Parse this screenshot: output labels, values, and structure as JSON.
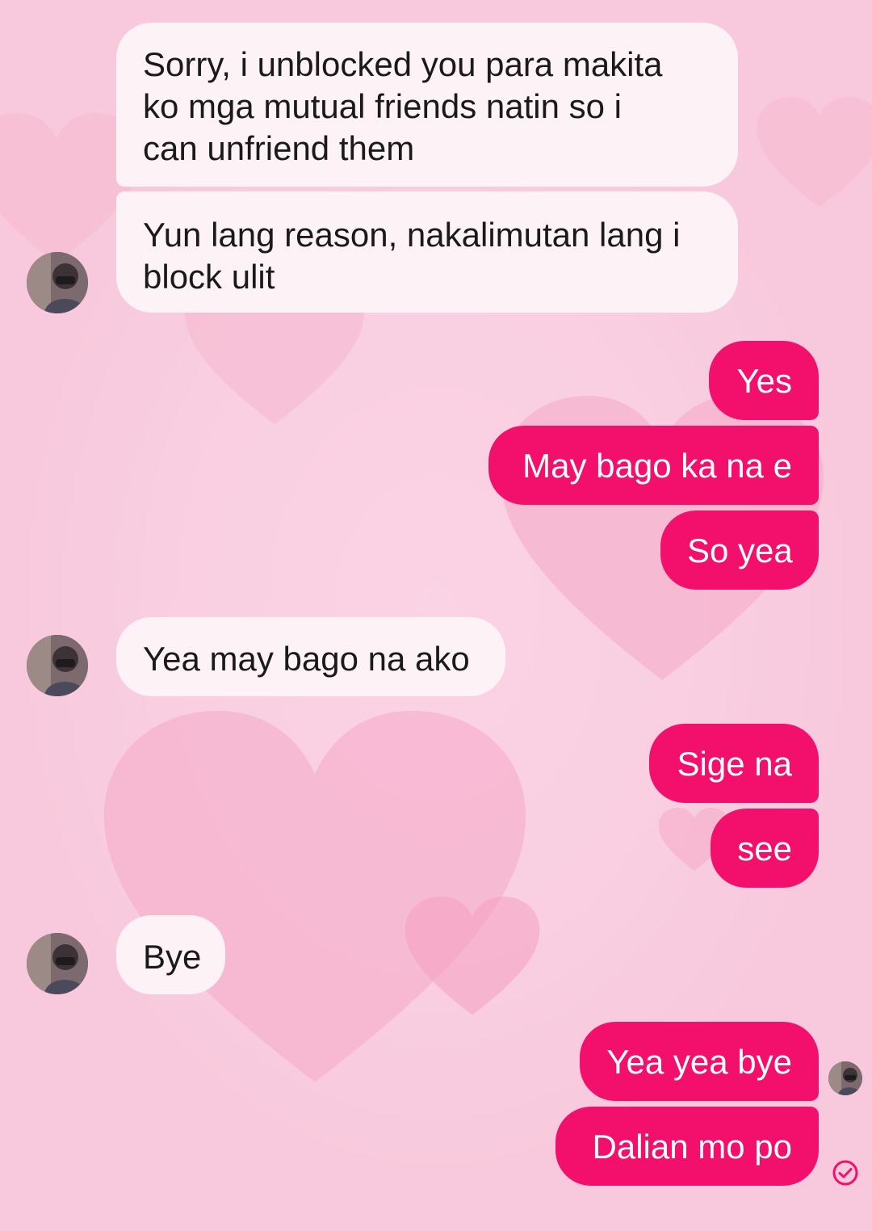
{
  "theme": {
    "incoming_bubble": "#fdf2f5",
    "outgoing_bubble": "#f2106c",
    "background": "#f9cde0"
  },
  "messages": [
    {
      "from": "them",
      "lines": [
        "Sorry, i unblocked you para makita",
        "ko mga mutual friends natin so i",
        "can unfriend them"
      ]
    },
    {
      "from": "them",
      "lines": [
        "Yun lang reason, nakalimutan lang i",
        "block ulit"
      ]
    },
    {
      "from": "me",
      "lines": [
        "Yes"
      ]
    },
    {
      "from": "me",
      "lines": [
        "May bago ka na e"
      ]
    },
    {
      "from": "me",
      "lines": [
        "So yea"
      ]
    },
    {
      "from": "them",
      "lines": [
        "Yea may bago na ako"
      ]
    },
    {
      "from": "me",
      "lines": [
        "Sige na"
      ]
    },
    {
      "from": "me",
      "lines": [
        "see"
      ]
    },
    {
      "from": "them",
      "lines": [
        "Bye"
      ]
    },
    {
      "from": "me",
      "lines": [
        "Yea yea bye"
      ]
    },
    {
      "from": "me",
      "lines": [
        "Dalian mo po"
      ]
    }
  ],
  "icons": {
    "contact_avatar": "avatar-icon",
    "seen_avatar": "seen-avatar-icon",
    "sent_status": "check-circle-icon"
  }
}
